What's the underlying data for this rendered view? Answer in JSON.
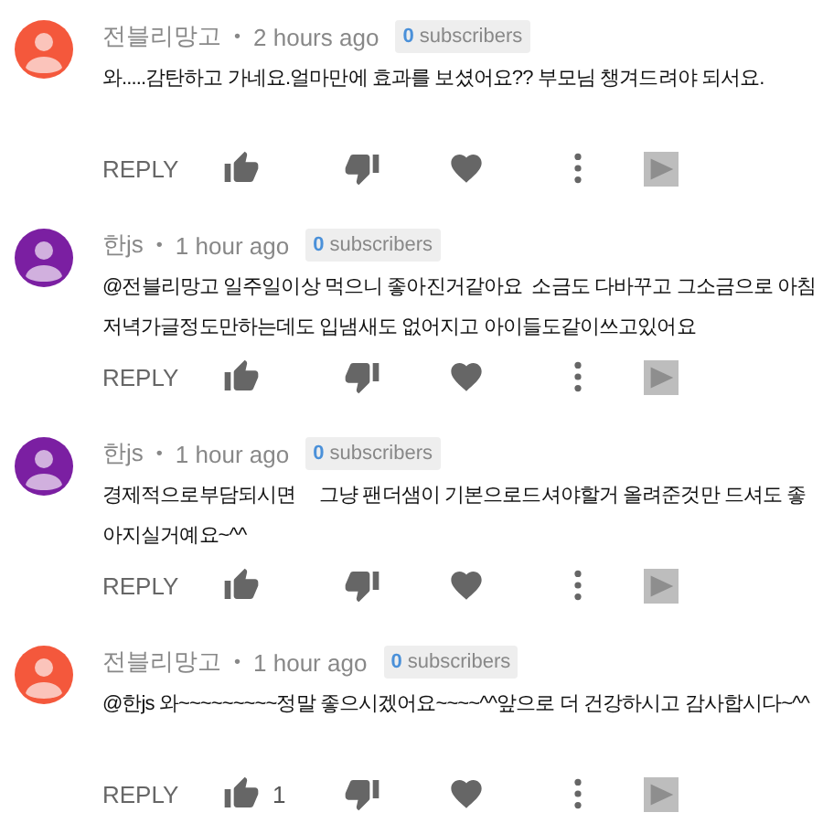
{
  "comments": [
    {
      "author": "전블리망고",
      "separator": "•",
      "time": "2 hours ago",
      "subscribers_count": "0",
      "subscribers_label": "subscribers",
      "color": "#f4583c",
      "text": "와.....감탄하고 가네요.얼마만에 효과를 보셨어요?? 부모님 챙겨드려야 되서요.",
      "reply": "REPLY"
    },
    {
      "author": "한js",
      "separator": "•",
      "time": "1 hour ago",
      "subscribers_count": "0",
      "subscribers_label": "subscribers",
      "color": "#7b1fa2",
      "text": "@전블리망고 일주일이상 먹으니 좋아진거같아요  소금도 다바꾸고 그소금으로 아침저녁가글정도만하는데도 입냄새도 없어지고 아이들도같이쓰고있어요",
      "reply": "REPLY"
    },
    {
      "author": "한js",
      "separator": "•",
      "time": "1 hour ago",
      "subscribers_count": "0",
      "subscribers_label": "subscribers",
      "color": "#7b1fa2",
      "text": "경제적으로부담되시면     그냥 팬더샘이 기본으로드셔야할거 올려준것만 드셔도 좋아지실거예요~^^",
      "reply": "REPLY"
    },
    {
      "author": "전블리망고",
      "separator": "•",
      "time": "1 hour ago",
      "subscribers_count": "0",
      "subscribers_label": "subscribers",
      "color": "#f4583c",
      "text": "@한js 와~~~~~~~~~정말 좋으시겠어요~~~~^^앞으로 더 건강하시고 감사합시다~^^",
      "reply": "REPLY",
      "likes": "1"
    }
  ]
}
